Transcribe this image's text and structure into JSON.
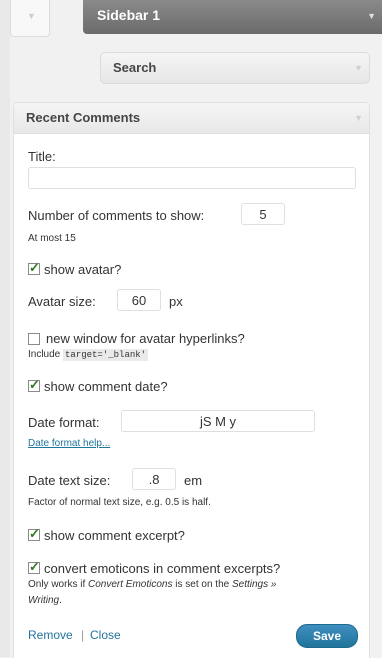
{
  "sidebar": {
    "title": "Sidebar 1"
  },
  "search_widget": {
    "title": "Search"
  },
  "recent_comments": {
    "title": "Recent Comments",
    "fields": {
      "title_label": "Title:",
      "title_value": "",
      "num_comments_label": "Number of comments to show:",
      "num_comments_value": "5",
      "num_comments_hint": "At most 15",
      "show_avatar_label": "show avatar?",
      "show_avatar_checked": true,
      "avatar_size_label": "Avatar size:",
      "avatar_size_value": "60",
      "avatar_size_unit": "px",
      "new_window_label": "new window for avatar hyperlinks?",
      "new_window_checked": false,
      "new_window_hint_prefix": "Include",
      "new_window_hint_code": "target='_blank'",
      "show_date_label": "show comment date?",
      "show_date_checked": true,
      "date_format_label": "Date format:",
      "date_format_value": "jS M y",
      "date_format_help": "Date format help...",
      "date_text_size_label": "Date text size:",
      "date_text_size_value": ".8",
      "date_text_size_unit": "em",
      "date_text_size_hint": "Factor of normal text size, e.g. 0.5 is half.",
      "show_excerpt_label": "show comment excerpt?",
      "show_excerpt_checked": true,
      "convert_emoticons_label": "convert emoticons in comment excerpts?",
      "convert_emoticons_checked": true,
      "emoticons_hint_1": "Only works if",
      "emoticons_hint_2": "Convert Emoticons",
      "emoticons_hint_3": "is set on the",
      "emoticons_hint_4": "Settings »",
      "emoticons_hint_5": "Writing",
      "emoticons_hint_6": "."
    },
    "footer": {
      "remove": "Remove",
      "separator": "|",
      "close": "Close",
      "save": "Save"
    }
  },
  "icons": {
    "arrow": "▼"
  }
}
